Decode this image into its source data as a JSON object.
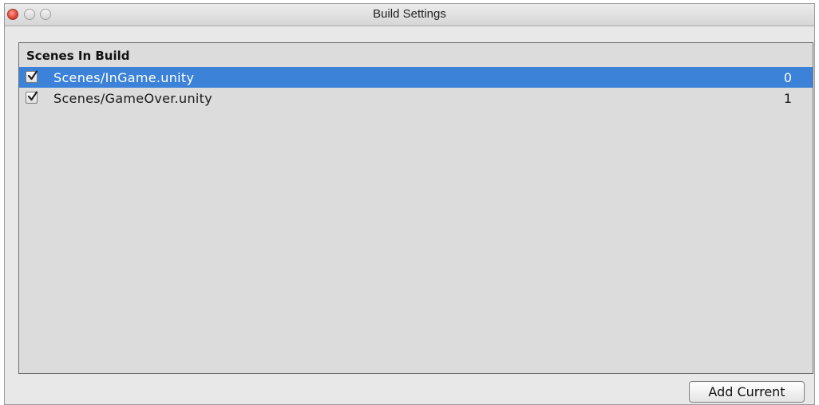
{
  "window": {
    "title": "Build Settings"
  },
  "scenes_panel": {
    "header": "Scenes In Build",
    "scenes": [
      {
        "name": "Scenes/InGame.unity",
        "index": "0",
        "checked": true,
        "selected": true
      },
      {
        "name": "Scenes/GameOver.unity",
        "index": "1",
        "checked": true,
        "selected": false
      }
    ]
  },
  "buttons": {
    "add_current": "Add Current"
  },
  "colors": {
    "selection": "#3c82d8",
    "panel_bg": "#dcdcdc",
    "window_bg": "#e8e8e8",
    "close_button": "#e0443a"
  }
}
